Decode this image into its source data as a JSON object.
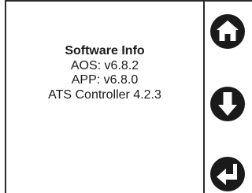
{
  "software_info": {
    "title": "Software Info",
    "lines": [
      "AOS: v6.8.2",
      "APP:  v6.8.0",
      "ATS Controller 4.2.3"
    ]
  },
  "softkeys": [
    {
      "icon": "home-icon"
    },
    {
      "icon": "arrow-down-icon"
    },
    {
      "icon": "enter-return-icon"
    }
  ],
  "colors": {
    "icon_fill": "#1a1a1a",
    "background": "#ffffff",
    "lines": "#2b2b2b"
  }
}
